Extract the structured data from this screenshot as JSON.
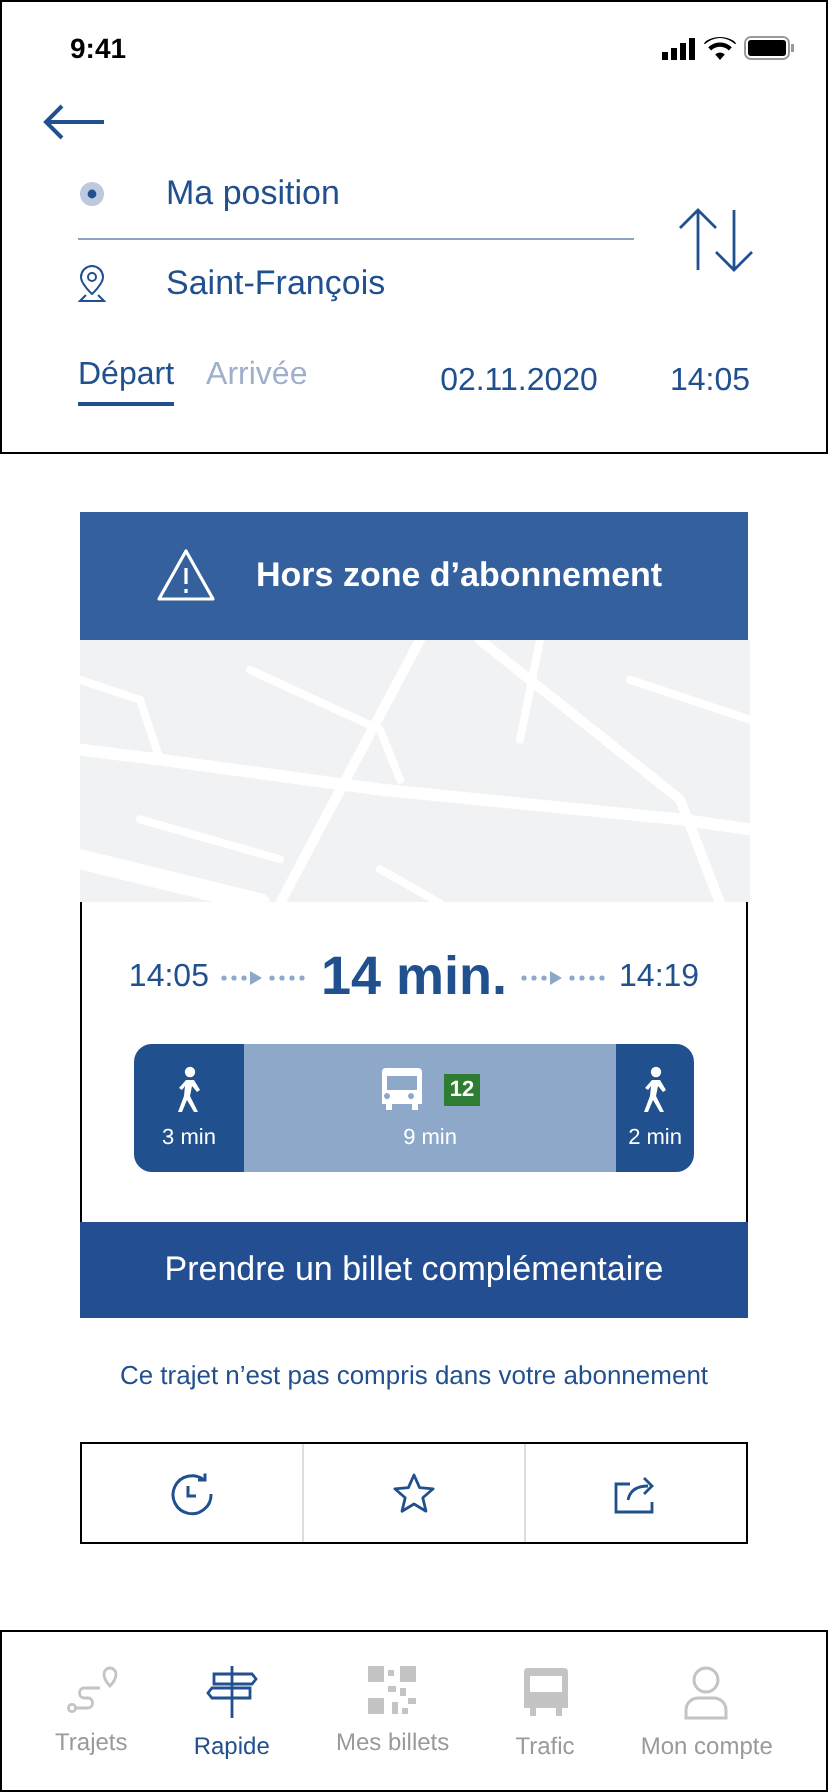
{
  "status_bar": {
    "time": "9:41"
  },
  "route": {
    "from": "Ma position",
    "to": "Saint-François"
  },
  "mode_tabs": [
    {
      "label": "Départ",
      "selected": true
    },
    {
      "label": "Arrivée",
      "selected": false
    }
  ],
  "date": "02.11.2020",
  "time": "14:05",
  "trip": {
    "warning": "Hors zone d’abonnement",
    "departure": "14:05",
    "duration": "14 min.",
    "arrival": "14:19",
    "legs": [
      {
        "kind": "walk",
        "duration": "3 min"
      },
      {
        "kind": "bus",
        "duration": "9 min",
        "line": "12",
        "color": "#2e7d32"
      },
      {
        "kind": "walk",
        "duration": "2 min"
      }
    ],
    "button": "Prendre un billet complémentaire",
    "note": "Ce trajet n’est pas compris dans votre abonnement"
  },
  "nav": [
    {
      "label": "Trajets",
      "selected": false
    },
    {
      "label": "Rapide",
      "selected": true
    },
    {
      "label": "Mes billets",
      "selected": false
    },
    {
      "label": "Trafic",
      "selected": false
    },
    {
      "label": "Mon compte",
      "selected": false
    }
  ]
}
